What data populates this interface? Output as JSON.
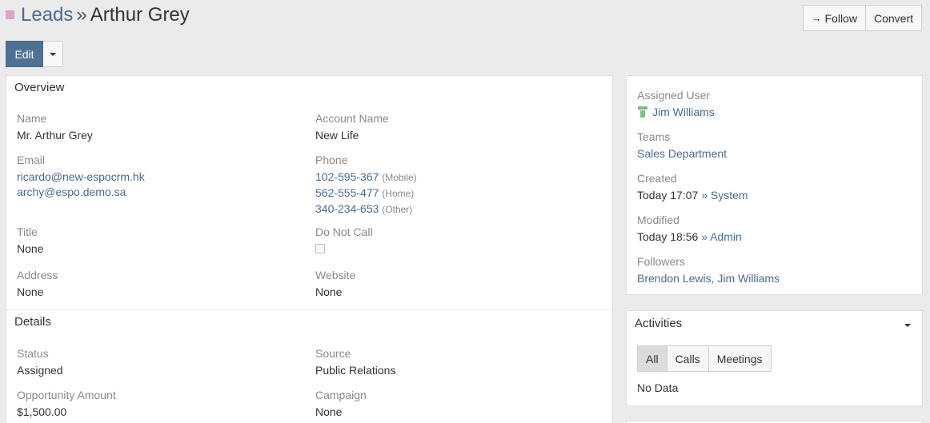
{
  "header": {
    "scope": "Leads",
    "separator": "»",
    "record_name": "Arthur Grey",
    "follow_label": "Follow",
    "convert_label": "Convert",
    "edit_label": "Edit",
    "accent_color": "#d9a6c9"
  },
  "overview": {
    "heading": "Overview",
    "name_label": "Name",
    "name_value": "Mr. Arthur Grey",
    "account_label": "Account Name",
    "account_value": "New Life",
    "email_label": "Email",
    "emails": [
      "ricardo@new-espocrm.hk",
      "archy@espo.demo.sa"
    ],
    "phone_label": "Phone",
    "phones": [
      {
        "number": "102-595-367",
        "type": "(Mobile)"
      },
      {
        "number": "562-555-477",
        "type": "(Home)"
      },
      {
        "number": "340-234-653",
        "type": "(Other)"
      }
    ],
    "title_label": "Title",
    "title_value": "None",
    "dnc_label": "Do Not Call",
    "address_label": "Address",
    "address_value": "None",
    "website_label": "Website",
    "website_value": "None"
  },
  "details": {
    "heading": "Details",
    "status_label": "Status",
    "status_value": "Assigned",
    "source_label": "Source",
    "source_value": "Public Relations",
    "opp_label": "Opportunity Amount",
    "opp_value": "$1,500.00",
    "campaign_label": "Campaign",
    "campaign_value": "None"
  },
  "side": {
    "assigned_label": "Assigned User",
    "assigned_value": "Jim Williams",
    "teams_label": "Teams",
    "teams_value": "Sales Department",
    "created_label": "Created",
    "created_time": "Today 17:07",
    "created_by": "» System",
    "modified_label": "Modified",
    "modified_time": "Today 18:56",
    "modified_by": "» Admin",
    "followers_label": "Followers",
    "followers_value": "Brendon Lewis, Jim Williams"
  },
  "activities": {
    "heading": "Activities",
    "tabs": [
      "All",
      "Calls",
      "Meetings"
    ],
    "empty_text": "No Data"
  }
}
